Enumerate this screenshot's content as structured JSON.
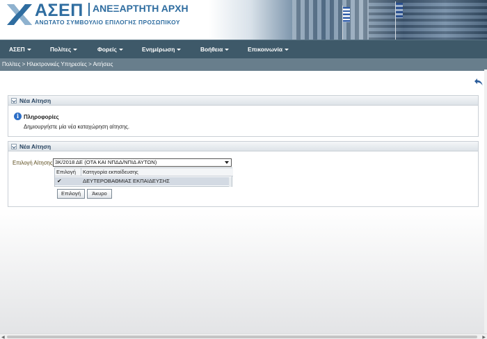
{
  "header": {
    "logo_name": "ΑΣΕΠ",
    "authority": "ΑΝΕΞΑΡΤΗΤΗ ΑΡΧΗ",
    "subtitle": "ΑΝΩΤΑΤΟ ΣΥΜΒΟΥΛΙΟ ΕΠΙΛΟΓΗΣ ΠΡΟΣΩΠΙΚΟΥ",
    "brand_color": "#2f6da0"
  },
  "nav": {
    "items": [
      {
        "label": "ΑΣΕΠ"
      },
      {
        "label": "Πολίτες"
      },
      {
        "label": "Φορείς"
      },
      {
        "label": "Ενημέρωση"
      },
      {
        "label": "Βοήθεια"
      },
      {
        "label": "Επικοινωνία"
      }
    ],
    "bg_color": "#3e5969"
  },
  "breadcrumb": "Πολίτες > Ηλεκτρονικές Υπηρεσίες > Αιτήσεις",
  "panel1": {
    "title": "Νέα Αίτηση",
    "info_title": "Πληροφορίες",
    "info_text": "Δημιουργήστε μία νέα καταχώρηση αίτησης."
  },
  "panel2": {
    "title": "Νέα Αίτηση",
    "select_label": "Επιλογή Αίτησης",
    "select_value": "3Κ/2018 ΔΕ (ΟΤΑ ΚΑΙ ΝΠΔΔ/ΝΠΙΔ ΑΥΤΩΝ)",
    "table": {
      "headers": [
        "Επιλογή",
        "Κατηγορία εκπαίδευσης"
      ],
      "rows": [
        {
          "checked": "✔",
          "category": "ΔΕΥΤΕΡΟΒΑΘΜΙΑΣ ΕΚΠΑΙΔΕΥΣΗΣ"
        }
      ]
    },
    "ok_label": "Επιλογή",
    "cancel_label": "Άκυρο"
  }
}
